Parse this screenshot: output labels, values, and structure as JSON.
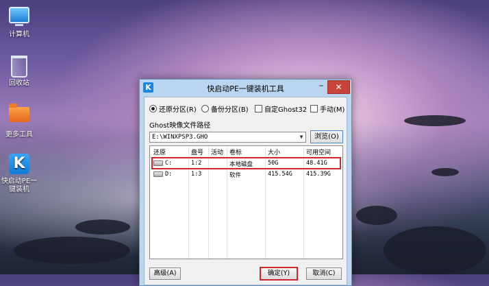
{
  "desktop": {
    "icons": [
      {
        "label": "计算机",
        "icon": "computer-icon"
      },
      {
        "label": "回收站",
        "icon": "recycle-bin-icon"
      },
      {
        "label": "更多工具",
        "icon": "folder-icon"
      },
      {
        "label": "快启动PE一键装机",
        "icon": "k-app-icon"
      }
    ]
  },
  "dialog": {
    "title": "快启动PE一键装机工具",
    "title_icon": "K",
    "minimize_glyph": "–",
    "close_glyph": "✕",
    "options": {
      "restore": "还原分区(R)",
      "backup": "备份分区(B)",
      "custom_ghost": "自定Ghost32",
      "manual": "手动(M)",
      "selected": "restore"
    },
    "ghost_label": "Ghost映像文件路径",
    "ghost_path": "E:\\WINXPSP3.GHO",
    "browse_label": "浏览(O)",
    "table": {
      "headers": [
        "还原",
        "盘号",
        "活动",
        "卷标",
        "大小",
        "可用空间"
      ],
      "rows": [
        {
          "drive": "C:",
          "disk": "1:2",
          "active": "",
          "label": "本地磁盘",
          "size": "50G",
          "free": "48.41G",
          "highlighted": true
        },
        {
          "drive": "D:",
          "disk": "1:3",
          "active": "",
          "label": "软件",
          "size": "415.54G",
          "free": "415.39G",
          "highlighted": false
        }
      ]
    },
    "buttons": {
      "advanced": "高级(A)",
      "ok": "确定(Y)",
      "cancel": "取消(C)"
    }
  },
  "colors": {
    "highlight": "#d0252a",
    "close_button": "#c7443b",
    "app_blue": "#1a86dc"
  }
}
